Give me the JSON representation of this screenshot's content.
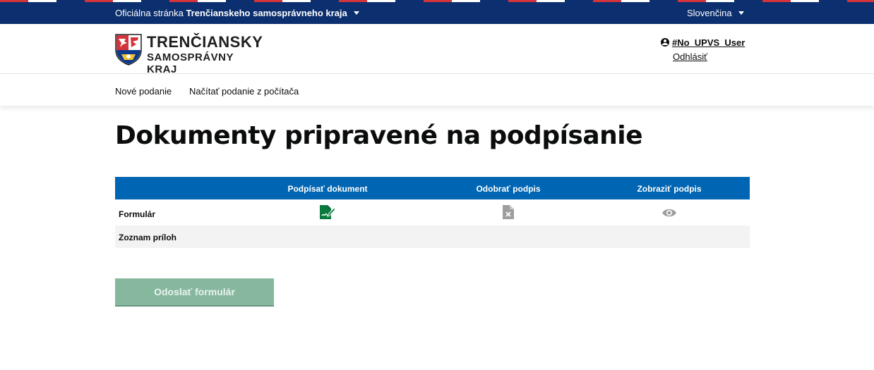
{
  "topbar": {
    "official_prefix": "Oficiálna stránka",
    "official_bold": "Trenčianskeho samosprávneho kraja",
    "language": "Slovenčina"
  },
  "header": {
    "logo_line1": "TRENČIANSKY",
    "logo_line2": "SAMOSPRÁVNY KRAJ",
    "user_name": "#No_UPVS_User",
    "logout": "Odhlásiť"
  },
  "nav": {
    "items": [
      {
        "label": "Nové podanie"
      },
      {
        "label": "Načítať podanie z počítača"
      }
    ]
  },
  "main": {
    "title": "Dokumenty pripravené na podpísanie",
    "table": {
      "columns": [
        "",
        "Podpísať dokument",
        "Odobrať podpis",
        "Zobraziť podpis"
      ],
      "rows": [
        {
          "label": "Formulár",
          "icons": [
            "sign-document-icon",
            "remove-signature-icon",
            "view-signature-icon"
          ]
        },
        {
          "label": "Zoznam príloh",
          "icons": []
        }
      ]
    },
    "submit_label": "Odoslať formulár"
  },
  "colors": {
    "topbar": "#0b2f6f",
    "table_header": "#0065b3",
    "sign_icon": "#0b7a3e",
    "submit_button": "#85b89d"
  }
}
